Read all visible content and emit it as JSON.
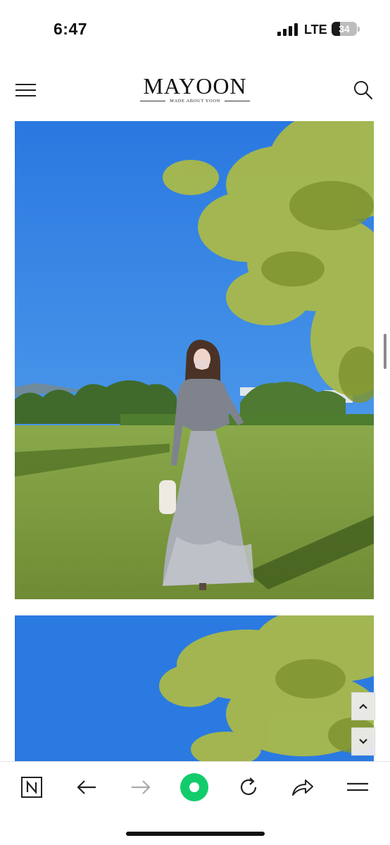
{
  "status_bar": {
    "time": "6:47",
    "carrier": "LTE",
    "battery_level": "34",
    "battery_fraction": 0.34
  },
  "header": {
    "logo_title": "MAYOON",
    "logo_subtitle": "MADE ABOUT YOON",
    "menu_icon": "hamburger-icon",
    "search_icon": "search-icon"
  },
  "content": {
    "photos": [
      "product-photo-full",
      "product-photo-partial"
    ]
  },
  "floating_buttons": {
    "up_icon": "chevron-up-icon",
    "down_icon": "chevron-down-icon"
  },
  "toolbar": {
    "items": [
      "naver-n-icon",
      "back-arrow-icon",
      "forward-arrow-icon",
      "green-dot-icon",
      "reload-icon",
      "share-icon",
      "menu-icon"
    ],
    "accent_color": "#12cc6b"
  },
  "colors": {
    "sky": "#2f7ee3",
    "grass": "#7d9a40",
    "foliage": "#a8b845"
  }
}
